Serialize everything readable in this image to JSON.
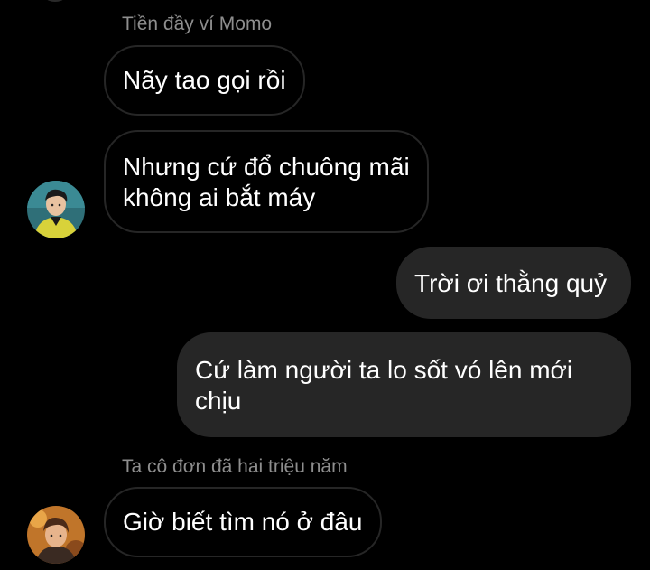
{
  "thread": {
    "groups": [
      {
        "sender": "Tiền đầy ví Momo",
        "messages": [
          "Nãy tao gọi rồi",
          "Nhưng cứ đổ chuông mãi",
          "không ai bắt máy"
        ]
      },
      {
        "sender": "",
        "outgoing": true,
        "messages": [
          "Trời ơi thằng quỷ",
          "Cứ làm người ta lo sốt vó lên mới",
          "chịu"
        ]
      },
      {
        "sender": "Ta cô đơn đã hai triệu năm",
        "messages": [
          "Giờ biết tìm nó ở đâu"
        ]
      }
    ]
  },
  "colors": {
    "background": "#000000",
    "incoming_border": "#262626",
    "outgoing_bubble": "#262626",
    "sender_name": "#8e8e8e",
    "text": "#ffffff"
  },
  "icons": {
    "avatar_1": "user-avatar-photo",
    "avatar_2": "user-avatar-photo"
  }
}
